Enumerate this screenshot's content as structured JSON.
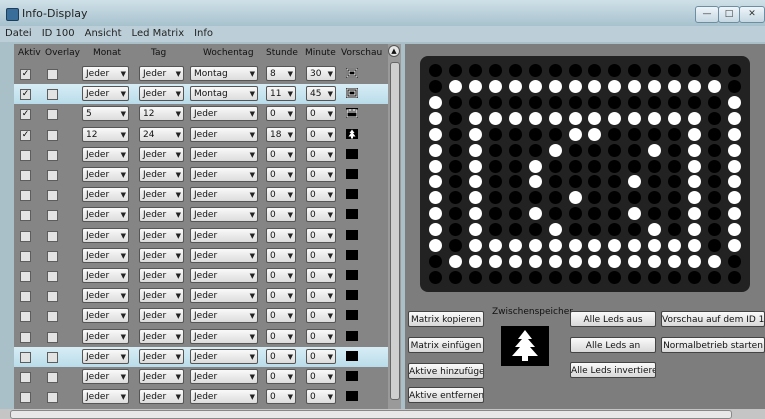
{
  "window": {
    "title": "Info-Display",
    "minimize_symbol": "—",
    "maximize_symbol": "□",
    "close_symbol": "✕",
    "accent_close": "#c8453a"
  },
  "menu": [
    "Datei",
    "ID 100",
    "Ansicht",
    "Led Matrix",
    "Info"
  ],
  "table": {
    "headers": [
      "Aktiv",
      "Overlay",
      "Monat",
      "Tag",
      "Wochentag",
      "Stunde",
      "Minute",
      "Vorschau"
    ],
    "rows": [
      {
        "aktiv": true,
        "overlay": false,
        "monat": "Jeder",
        "tag": "Jeder",
        "wochentag": "Montag",
        "stunde": "8",
        "minute": "30",
        "preview": "clock-icon",
        "highlight": false
      },
      {
        "aktiv": true,
        "overlay": false,
        "monat": "Jeder",
        "tag": "Jeder",
        "wochentag": "Montag",
        "stunde": "11",
        "minute": "45",
        "preview": "clock-icon",
        "highlight": true
      },
      {
        "aktiv": true,
        "overlay": false,
        "monat": "5",
        "tag": "12",
        "wochentag": "Jeder",
        "stunde": "0",
        "minute": "0",
        "preview": "calendar-icon",
        "highlight": false
      },
      {
        "aktiv": true,
        "overlay": false,
        "monat": "12",
        "tag": "24",
        "wochentag": "Jeder",
        "stunde": "18",
        "minute": "0",
        "preview": "tree-icon",
        "highlight": false
      },
      {
        "aktiv": false,
        "overlay": false,
        "monat": "Jeder",
        "tag": "Jeder",
        "wochentag": "Jeder",
        "stunde": "0",
        "minute": "0",
        "preview": "blank",
        "highlight": false
      },
      {
        "aktiv": false,
        "overlay": false,
        "monat": "Jeder",
        "tag": "Jeder",
        "wochentag": "Jeder",
        "stunde": "0",
        "minute": "0",
        "preview": "blank",
        "highlight": false
      },
      {
        "aktiv": false,
        "overlay": false,
        "monat": "Jeder",
        "tag": "Jeder",
        "wochentag": "Jeder",
        "stunde": "0",
        "minute": "0",
        "preview": "blank",
        "highlight": false
      },
      {
        "aktiv": false,
        "overlay": false,
        "monat": "Jeder",
        "tag": "Jeder",
        "wochentag": "Jeder",
        "stunde": "0",
        "minute": "0",
        "preview": "blank",
        "highlight": false
      },
      {
        "aktiv": false,
        "overlay": false,
        "monat": "Jeder",
        "tag": "Jeder",
        "wochentag": "Jeder",
        "stunde": "0",
        "minute": "0",
        "preview": "blank",
        "highlight": false
      },
      {
        "aktiv": false,
        "overlay": false,
        "monat": "Jeder",
        "tag": "Jeder",
        "wochentag": "Jeder",
        "stunde": "0",
        "minute": "0",
        "preview": "blank",
        "highlight": false
      },
      {
        "aktiv": false,
        "overlay": false,
        "monat": "Jeder",
        "tag": "Jeder",
        "wochentag": "Jeder",
        "stunde": "0",
        "minute": "0",
        "preview": "blank",
        "highlight": false
      },
      {
        "aktiv": false,
        "overlay": false,
        "monat": "Jeder",
        "tag": "Jeder",
        "wochentag": "Jeder",
        "stunde": "0",
        "minute": "0",
        "preview": "blank",
        "highlight": false
      },
      {
        "aktiv": false,
        "overlay": false,
        "monat": "Jeder",
        "tag": "Jeder",
        "wochentag": "Jeder",
        "stunde": "0",
        "minute": "0",
        "preview": "blank",
        "highlight": false
      },
      {
        "aktiv": false,
        "overlay": false,
        "monat": "Jeder",
        "tag": "Jeder",
        "wochentag": "Jeder",
        "stunde": "0",
        "minute": "0",
        "preview": "blank",
        "highlight": false
      },
      {
        "aktiv": false,
        "overlay": false,
        "monat": "Jeder",
        "tag": "Jeder",
        "wochentag": "Jeder",
        "stunde": "0",
        "minute": "0",
        "preview": "blank",
        "highlight": true
      },
      {
        "aktiv": false,
        "overlay": false,
        "monat": "Jeder",
        "tag": "Jeder",
        "wochentag": "Jeder",
        "stunde": "0",
        "minute": "0",
        "preview": "blank",
        "highlight": false
      },
      {
        "aktiv": false,
        "overlay": false,
        "monat": "Jeder",
        "tag": "Jeder",
        "wochentag": "Jeder",
        "stunde": "0",
        "minute": "0",
        "preview": "blank",
        "highlight": false
      }
    ]
  },
  "matrix": {
    "on_color": "#ffffff",
    "off_color": "#000000",
    "grid": [
      "0000000000000000",
      "0111111111111110",
      "1000000000000001",
      "1011111111111101",
      "1010000110000101",
      "1010001000010101",
      "1010010000000101",
      "1010010000100101",
      "1010000100000101",
      "1010010000100101",
      "1010001000010101",
      "1011111111111101",
      "0111111111111110",
      "0000000000000000"
    ]
  },
  "buttons": {
    "matrix_kopieren": "Matrix kopieren",
    "matrix_einfuegen": "Matrix einfügen",
    "aktive_hinzufuegen": "Aktive hinzufügen",
    "aktive_entfernen": "Aktive entfernen",
    "alle_leds_aus": "Alle Leds aus",
    "alle_leds_an": "Alle Leds an",
    "alle_leds_invertieren": "Alle Leds invertieren",
    "vorschau_id100": "Vorschau auf dem ID 100",
    "normalbetrieb": "Normalbetrieb starten"
  },
  "zwischenspeicher": {
    "label": "Zwischenspeicher",
    "preview": "tree-icon"
  }
}
